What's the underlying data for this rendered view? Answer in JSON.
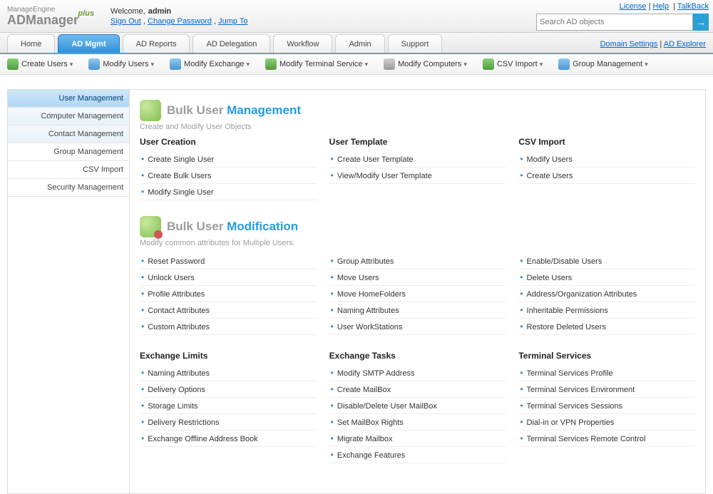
{
  "header": {
    "logo1": "ManageEngine",
    "logo2": "ADManager",
    "logo_plus": "plus",
    "welcome_label": "Welcome,",
    "welcome_user": "admin",
    "sign_out": "Sign Out",
    "change_pw": "Change Password",
    "jump_to": "Jump To",
    "license": "License",
    "help": "Help",
    "talkback": "TalkBack",
    "search_placeholder": "Search AD objects",
    "go_arrow": "→"
  },
  "tabs": {
    "items": [
      {
        "label": "Home"
      },
      {
        "label": "AD Mgmt"
      },
      {
        "label": "AD Reports"
      },
      {
        "label": "AD Delegation"
      },
      {
        "label": "Workflow"
      },
      {
        "label": "Admin"
      },
      {
        "label": "Support"
      }
    ],
    "right1": "Domain Settings",
    "right2": "AD Explorer"
  },
  "toolbar": {
    "items": [
      {
        "label": "Create Users"
      },
      {
        "label": "Modify Users"
      },
      {
        "label": "Modify Exchange"
      },
      {
        "label": "Modify Terminal Service"
      },
      {
        "label": "Modify Computers"
      },
      {
        "label": "CSV Import"
      },
      {
        "label": "Group Management"
      }
    ]
  },
  "sidebar": {
    "items": [
      {
        "label": "User Management"
      },
      {
        "label": "Computer Management"
      },
      {
        "label": "Contact Management"
      },
      {
        "label": "Group Management"
      },
      {
        "label": "CSV Import"
      },
      {
        "label": "Security Management"
      }
    ]
  },
  "section1": {
    "title_a": "Bulk User ",
    "title_b": "Management",
    "sub": "Create and Modify User Objects",
    "col1_h": "User Creation",
    "col1": [
      "Create Single User",
      "Create Bulk Users",
      "Modify Single User"
    ],
    "col2_h": "User Template",
    "col2": [
      "Create User Template",
      "View/Modify User Template"
    ],
    "col3_h": "CSV Import",
    "col3": [
      "Modify Users",
      "Create Users"
    ]
  },
  "section2": {
    "title_a": "Bulk User ",
    "title_b": "Modification",
    "sub": "Modify common attributes for Multiple Users.",
    "col1": [
      "Reset Password",
      "Unlock Users",
      "Profile Attributes",
      "Contact Attributes",
      "Custom Attributes"
    ],
    "col2": [
      "Group Attributes",
      "Move Users",
      "Move HomeFolders",
      "Naming Attributes",
      "User WorkStations"
    ],
    "col3": [
      "Enable/Disable Users",
      "Delete Users",
      "Address/Organization Attributes",
      "Inheritable Permissions",
      "Restore Deleted Users"
    ]
  },
  "section3": {
    "col1_h": "Exchange Limits",
    "col1": [
      "Naming Attributes",
      "Delivery Options",
      "Storage Limits",
      "Delivery Restrictions",
      "Exchange Offline Address Book"
    ],
    "col2_h": "Exchange Tasks",
    "col2": [
      "Modify SMTP Address",
      "Create MailBox",
      "Disable/Delete User MailBox",
      "Set MailBox Rights",
      "Migrate Mailbox",
      "Exchange Features"
    ],
    "col3_h": "Terminal Services",
    "col3": [
      "Terminal Services Profile",
      "Terminal Services Environment",
      "Terminal Services Sessions",
      "Dial-in or VPN Properties",
      "Terminal Services Remote Control"
    ]
  }
}
